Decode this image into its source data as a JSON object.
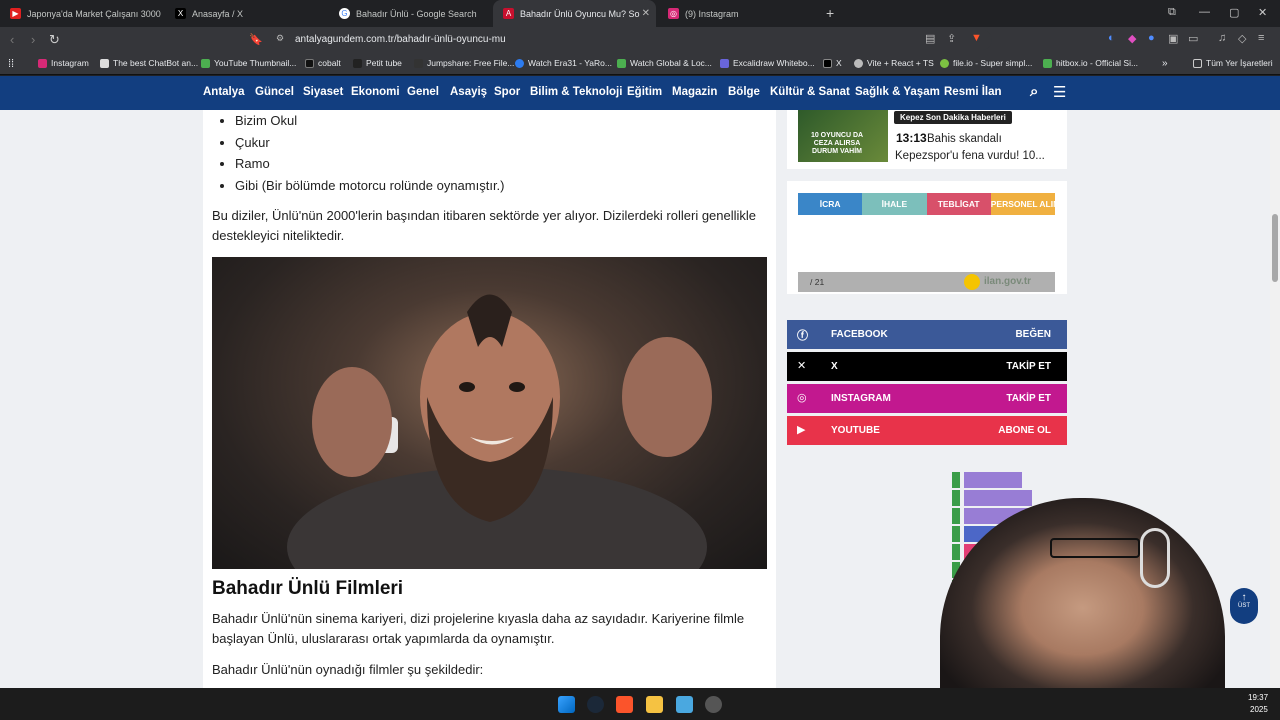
{
  "tabs": [
    {
      "title": "Japonya'da Market Çalışanı 3000 Dol",
      "color": "#e02020"
    },
    {
      "title": "Anasayfa / X",
      "color": "#000000"
    },
    {
      "title": "Bahadır Ünlü - Google Search",
      "color": "#4285f4"
    },
    {
      "title": "Bahadır Ünlü Oyuncu Mu? Sosya",
      "color": "#c8102e"
    },
    {
      "title": "(9) Instagram",
      "color": "#d62976"
    }
  ],
  "address": {
    "url": "antalyagundem.com.tr/bahadır-ünlü-oyuncu-mu"
  },
  "bookmarks": [
    "Instagram",
    "The best ChatBot an...",
    "YouTube Thumbnail...",
    "cobalt",
    "Petit tube",
    "Jumpshare: Free File...",
    "Watch Era31 - YaRo...",
    "Watch Global & Loc...",
    "Excalidraw Whitebo...",
    "X",
    "Vite + React + TS",
    "file.io - Super simpl...",
    "hitbox.io - Official Si..."
  ],
  "bookmarks_folder": "Tüm Yer İşaretleri",
  "site_nav": [
    "Antalya",
    "Güncel",
    "Siyaset",
    "Ekonomi",
    "Genel",
    "Asayiş",
    "Spor",
    "Bilim & Teknoloji",
    "Eğitim",
    "Magazin",
    "Bölge",
    "Kültür & Sanat",
    "Sağlık & Yaşam",
    "Resmi İlan"
  ],
  "article": {
    "list": [
      "Bizim Okul",
      "Çukur",
      "Ramo",
      "Gibi (Bir bölümde motorcu rolünde oynamıştır.)"
    ],
    "para1": "Bu diziler, Ünlü'nün 2000'lerin başından itibaren sektörde yer alıyor. Dizilerdeki rolleri genellikle destekleyici niteliktedir.",
    "heading": "Bahadır Ünlü Filmleri",
    "para2": "Bahadır Ünlü'nün sinema kariyeri, dizi projelerine kıyasla daha az sayıdadır. Kariyerine filmle başlayan Ünlü, uluslararası ortak yapımlarda da oynamıştır.",
    "para3": "Bahadır Ünlü'nün oynadığı filmler şu şekildedir:"
  },
  "sidebar": {
    "news_badge": "Kepez Son Dakika Haberleri",
    "news_time": "13:13",
    "news_text": "Bahis skandalı Kepezspor'u fena vurdu! 10...",
    "ilan_tabs": [
      {
        "label": "İCRA",
        "color": "#3a86c8"
      },
      {
        "label": "İHALE",
        "color": "#7cbfbb"
      },
      {
        "label": "TEBLİGAT",
        "color": "#d8506a"
      },
      {
        "label": "PERSONEL ALIM",
        "color": "#f0b040"
      }
    ],
    "ilan_counter": "/ 21",
    "ilan_logo": "ilan.gov.tr"
  },
  "social": [
    {
      "name": "FACEBOOK",
      "action": "BEĞEN",
      "color": "#3b5998",
      "icon": "f"
    },
    {
      "name": "X",
      "action": "TAKİP ET",
      "color": "#000000",
      "icon": "𝕏"
    },
    {
      "name": "INSTAGRAM",
      "action": "TAKİP ET",
      "color": "#c2188f",
      "icon": "◎"
    },
    {
      "name": "YOUTUBE",
      "action": "ABONE OL",
      "color": "#e8334a",
      "icon": "▶"
    }
  ],
  "scroll_top": {
    "label": "ÜST"
  },
  "clock": {
    "time": "19:37",
    "year": "2025"
  }
}
